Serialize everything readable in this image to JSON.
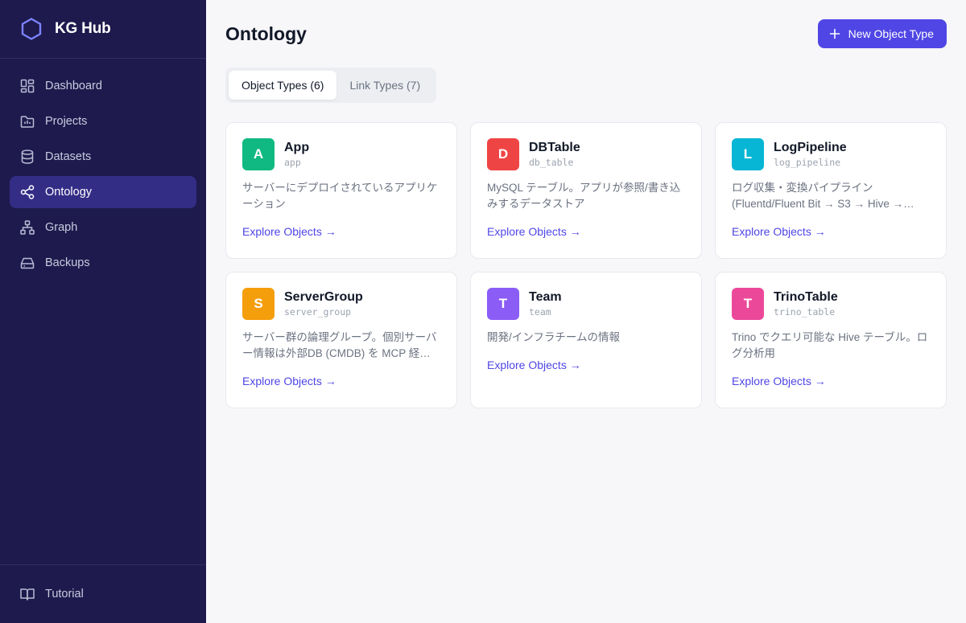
{
  "app": {
    "title": "KG Hub"
  },
  "sidebar": {
    "items": [
      {
        "label": "Dashboard",
        "icon": "dashboard-icon",
        "active": false
      },
      {
        "label": "Projects",
        "icon": "folder-chart-icon",
        "active": false
      },
      {
        "label": "Datasets",
        "icon": "database-icon",
        "active": false
      },
      {
        "label": "Ontology",
        "icon": "share-nodes-icon",
        "active": true
      },
      {
        "label": "Graph",
        "icon": "hierarchy-icon",
        "active": false
      },
      {
        "label": "Backups",
        "icon": "hard-drive-icon",
        "active": false
      }
    ],
    "bottom": {
      "label": "Tutorial",
      "icon": "book-open-icon"
    }
  },
  "page": {
    "title": "Ontology",
    "new_button_label": "New Object Type",
    "tabs": [
      {
        "label": "Object Types (6)",
        "active": true
      },
      {
        "label": "Link Types (7)",
        "active": false
      }
    ]
  },
  "colors": {
    "sidebar_bg": "#1e1a4d",
    "sidebar_active": "#332d86",
    "accent": "#4f46e5"
  },
  "object_types": [
    {
      "letter": "A",
      "name": "App",
      "api_name": "app",
      "color": "#10b981",
      "description": "サーバーにデプロイされているアプリケーション",
      "link": "Explore Objects →"
    },
    {
      "letter": "D",
      "name": "DBTable",
      "api_name": "db_table",
      "color": "#ef4444",
      "description": "MySQL テーブル。アプリが参照/書き込みするデータストア",
      "link": "Explore Objects →"
    },
    {
      "letter": "L",
      "name": "LogPipeline",
      "api_name": "log_pipeline",
      "color": "#06b6d4",
      "description": "ログ収集・変換パイプライン (Fluentd/Fluent Bit → S3 → Hive →…",
      "link": "Explore Objects →"
    },
    {
      "letter": "S",
      "name": "ServerGroup",
      "api_name": "server_group",
      "color": "#f59e0b",
      "description": "サーバー群の論理グループ。個別サーバー情報は外部DB (CMDB) を MCP 経…",
      "link": "Explore Objects →"
    },
    {
      "letter": "T",
      "name": "Team",
      "api_name": "team",
      "color": "#8b5cf6",
      "description": "開発/インフラチームの情報",
      "link": "Explore Objects →"
    },
    {
      "letter": "T",
      "name": "TrinoTable",
      "api_name": "trino_table",
      "color": "#ec4899",
      "description": "Trino でクエリ可能な Hive テーブル。ログ分析用",
      "link": "Explore Objects →"
    }
  ]
}
